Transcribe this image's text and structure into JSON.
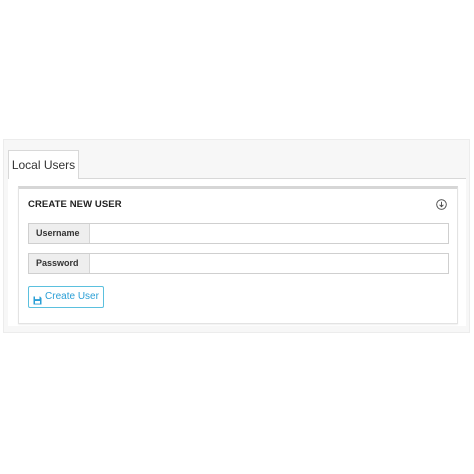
{
  "tabs": {
    "local_users": "Local Users"
  },
  "panel": {
    "title": "CREATE NEW USER",
    "collapse_icon": "circle-arrow-down-icon"
  },
  "form": {
    "username_label": "Username",
    "username_value": "",
    "password_label": "Password",
    "password_value": ""
  },
  "actions": {
    "create_user_label": "Create User",
    "create_user_icon": "floppy-disk-icon"
  },
  "colors": {
    "accent": "#2a9fd6",
    "button_border": "#5bc0de"
  }
}
